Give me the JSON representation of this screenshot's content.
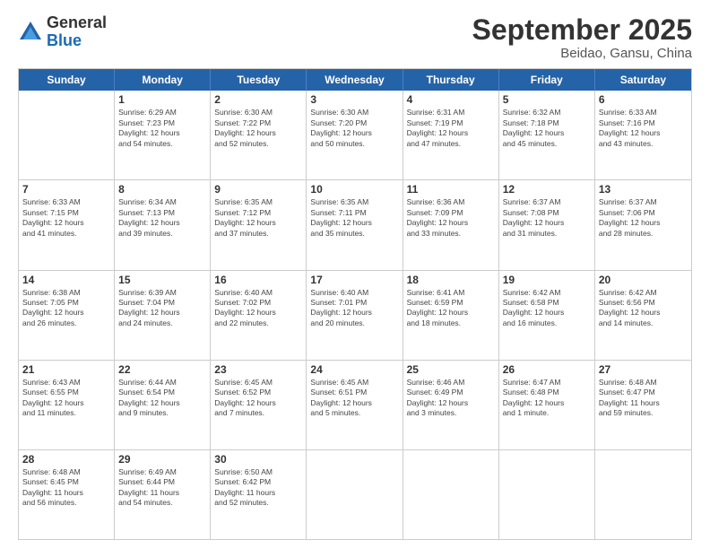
{
  "logo": {
    "general": "General",
    "blue": "Blue"
  },
  "title": "September 2025",
  "subtitle": "Beidao, Gansu, China",
  "days": [
    "Sunday",
    "Monday",
    "Tuesday",
    "Wednesday",
    "Thursday",
    "Friday",
    "Saturday"
  ],
  "weeks": [
    [
      {
        "day": "",
        "info": ""
      },
      {
        "day": "1",
        "info": "Sunrise: 6:29 AM\nSunset: 7:23 PM\nDaylight: 12 hours\nand 54 minutes."
      },
      {
        "day": "2",
        "info": "Sunrise: 6:30 AM\nSunset: 7:22 PM\nDaylight: 12 hours\nand 52 minutes."
      },
      {
        "day": "3",
        "info": "Sunrise: 6:30 AM\nSunset: 7:20 PM\nDaylight: 12 hours\nand 50 minutes."
      },
      {
        "day": "4",
        "info": "Sunrise: 6:31 AM\nSunset: 7:19 PM\nDaylight: 12 hours\nand 47 minutes."
      },
      {
        "day": "5",
        "info": "Sunrise: 6:32 AM\nSunset: 7:18 PM\nDaylight: 12 hours\nand 45 minutes."
      },
      {
        "day": "6",
        "info": "Sunrise: 6:33 AM\nSunset: 7:16 PM\nDaylight: 12 hours\nand 43 minutes."
      }
    ],
    [
      {
        "day": "7",
        "info": "Sunrise: 6:33 AM\nSunset: 7:15 PM\nDaylight: 12 hours\nand 41 minutes."
      },
      {
        "day": "8",
        "info": "Sunrise: 6:34 AM\nSunset: 7:13 PM\nDaylight: 12 hours\nand 39 minutes."
      },
      {
        "day": "9",
        "info": "Sunrise: 6:35 AM\nSunset: 7:12 PM\nDaylight: 12 hours\nand 37 minutes."
      },
      {
        "day": "10",
        "info": "Sunrise: 6:35 AM\nSunset: 7:11 PM\nDaylight: 12 hours\nand 35 minutes."
      },
      {
        "day": "11",
        "info": "Sunrise: 6:36 AM\nSunset: 7:09 PM\nDaylight: 12 hours\nand 33 minutes."
      },
      {
        "day": "12",
        "info": "Sunrise: 6:37 AM\nSunset: 7:08 PM\nDaylight: 12 hours\nand 31 minutes."
      },
      {
        "day": "13",
        "info": "Sunrise: 6:37 AM\nSunset: 7:06 PM\nDaylight: 12 hours\nand 28 minutes."
      }
    ],
    [
      {
        "day": "14",
        "info": "Sunrise: 6:38 AM\nSunset: 7:05 PM\nDaylight: 12 hours\nand 26 minutes."
      },
      {
        "day": "15",
        "info": "Sunrise: 6:39 AM\nSunset: 7:04 PM\nDaylight: 12 hours\nand 24 minutes."
      },
      {
        "day": "16",
        "info": "Sunrise: 6:40 AM\nSunset: 7:02 PM\nDaylight: 12 hours\nand 22 minutes."
      },
      {
        "day": "17",
        "info": "Sunrise: 6:40 AM\nSunset: 7:01 PM\nDaylight: 12 hours\nand 20 minutes."
      },
      {
        "day": "18",
        "info": "Sunrise: 6:41 AM\nSunset: 6:59 PM\nDaylight: 12 hours\nand 18 minutes."
      },
      {
        "day": "19",
        "info": "Sunrise: 6:42 AM\nSunset: 6:58 PM\nDaylight: 12 hours\nand 16 minutes."
      },
      {
        "day": "20",
        "info": "Sunrise: 6:42 AM\nSunset: 6:56 PM\nDaylight: 12 hours\nand 14 minutes."
      }
    ],
    [
      {
        "day": "21",
        "info": "Sunrise: 6:43 AM\nSunset: 6:55 PM\nDaylight: 12 hours\nand 11 minutes."
      },
      {
        "day": "22",
        "info": "Sunrise: 6:44 AM\nSunset: 6:54 PM\nDaylight: 12 hours\nand 9 minutes."
      },
      {
        "day": "23",
        "info": "Sunrise: 6:45 AM\nSunset: 6:52 PM\nDaylight: 12 hours\nand 7 minutes."
      },
      {
        "day": "24",
        "info": "Sunrise: 6:45 AM\nSunset: 6:51 PM\nDaylight: 12 hours\nand 5 minutes."
      },
      {
        "day": "25",
        "info": "Sunrise: 6:46 AM\nSunset: 6:49 PM\nDaylight: 12 hours\nand 3 minutes."
      },
      {
        "day": "26",
        "info": "Sunrise: 6:47 AM\nSunset: 6:48 PM\nDaylight: 12 hours\nand 1 minute."
      },
      {
        "day": "27",
        "info": "Sunrise: 6:48 AM\nSunset: 6:47 PM\nDaylight: 11 hours\nand 59 minutes."
      }
    ],
    [
      {
        "day": "28",
        "info": "Sunrise: 6:48 AM\nSunset: 6:45 PM\nDaylight: 11 hours\nand 56 minutes."
      },
      {
        "day": "29",
        "info": "Sunrise: 6:49 AM\nSunset: 6:44 PM\nDaylight: 11 hours\nand 54 minutes."
      },
      {
        "day": "30",
        "info": "Sunrise: 6:50 AM\nSunset: 6:42 PM\nDaylight: 11 hours\nand 52 minutes."
      },
      {
        "day": "",
        "info": ""
      },
      {
        "day": "",
        "info": ""
      },
      {
        "day": "",
        "info": ""
      },
      {
        "day": "",
        "info": ""
      }
    ]
  ]
}
